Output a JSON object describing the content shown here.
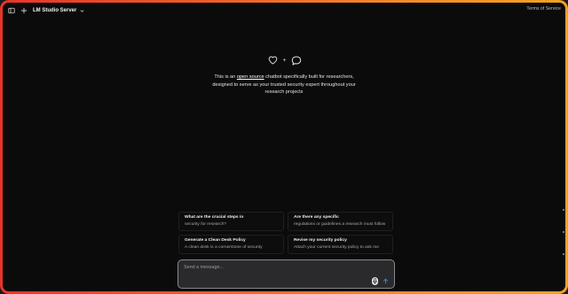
{
  "topbar": {
    "model_name": "LM Studio Server",
    "terms_link": "Terms of Service"
  },
  "hero": {
    "line1_before": "This is an ",
    "link_text": "open source",
    "line1_after": " chatbot specifically built for researchers,",
    "line2": "designed to serve as your trusted security expert throughout your",
    "line3": "research projects",
    "plus": "+"
  },
  "suggestions": [
    {
      "title": "What are the crucial steps in",
      "subtitle": "security for research?"
    },
    {
      "title": "Are there any specific",
      "subtitle": "regulations or guidelines a research must follow"
    },
    {
      "title": "Generate a Clean Desk Policy",
      "subtitle": "A clean desk is a cornerstone of security"
    },
    {
      "title": "Revise my security policy",
      "subtitle": "Attach your current security policy to ask me"
    }
  ],
  "composer": {
    "placeholder": "Send a message..."
  },
  "colors": {
    "frame_gradient_start": "#e8342a",
    "frame_gradient_end": "#f7a21f",
    "background": "#0b0b0c",
    "composer_bg": "#2a2a2c"
  },
  "icons": {
    "sidebar_toggle": "sidebar-panel-icon",
    "new_chat": "plus-icon",
    "model_dropdown": "chevron-down-icon",
    "hero_left": "heart-icon",
    "hero_right": "chat-bubble-icon",
    "mic": "microphone-icon",
    "send": "arrow-up-icon"
  }
}
